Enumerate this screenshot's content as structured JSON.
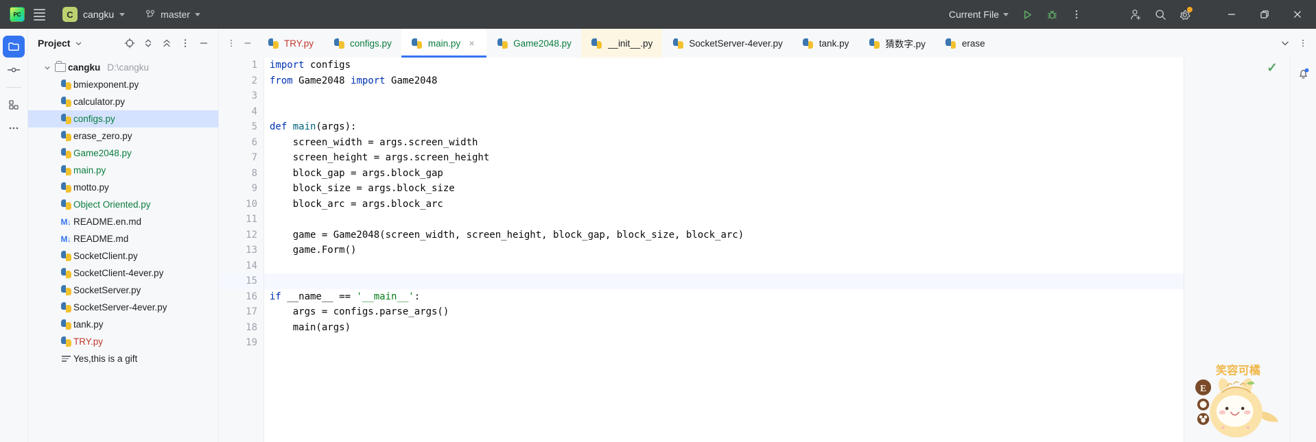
{
  "titlebar": {
    "logo_icon": "pycharm-logo-icon",
    "menu_icon": "hamburger-menu-icon",
    "project_initial": "C",
    "project_name": "cangku",
    "branch_icon": "git-branch-icon",
    "branch_name": "master",
    "run_config": "Current File",
    "run_icon": "run-play-icon",
    "debug_icon": "debug-bug-icon",
    "more_icon": "more-vertical-icon",
    "account_icon": "add-account-icon",
    "search_icon": "search-icon",
    "settings_icon": "gear-icon",
    "minimize_icon": "minimize-icon",
    "maximize_icon": "restore-window-icon",
    "close_icon": "close-icon"
  },
  "rail": {
    "items": [
      {
        "name": "project-tool-window",
        "icon": "folder-icon",
        "active": true
      },
      {
        "name": "commit-tool-window",
        "icon": "commit-icon",
        "active": false
      },
      {
        "name": "structure-tool-window",
        "icon": "structure-blocks-icon",
        "active": false
      },
      {
        "name": "more-tool-windows",
        "icon": "ellipsis-icon",
        "active": false
      }
    ]
  },
  "project_panel": {
    "title": "Project",
    "title_caret_icon": "chevron-down-icon",
    "actions": [
      {
        "name": "select-opened-file-button",
        "icon": "target-icon"
      },
      {
        "name": "expand-collapse-button",
        "icon": "expand-collapse-icon"
      },
      {
        "name": "collapse-all-button",
        "icon": "collapse-all-icon"
      },
      {
        "name": "options-button",
        "icon": "more-vertical-icon"
      },
      {
        "name": "hide-button",
        "icon": "minimize-dash-icon"
      }
    ],
    "root": {
      "label": "cangku",
      "path": "D:\\cangku",
      "icon": "folder-icon",
      "expanded": true
    },
    "files": [
      {
        "label": "bmiexponent.py",
        "icon": "python-file-icon",
        "color": "#1e1f22",
        "selected": false
      },
      {
        "label": "calculator.py",
        "icon": "python-file-icon",
        "color": "#1e1f22",
        "selected": false
      },
      {
        "label": "configs.py",
        "icon": "python-file-icon",
        "color": "#0a7d3e",
        "selected": true
      },
      {
        "label": "erase_zero.py",
        "icon": "python-file-icon",
        "color": "#1e1f22",
        "selected": false
      },
      {
        "label": "Game2048.py",
        "icon": "python-file-icon",
        "color": "#0a7d3e",
        "selected": false
      },
      {
        "label": "main.py",
        "icon": "python-file-icon",
        "color": "#0a7d3e",
        "selected": false
      },
      {
        "label": "motto.py",
        "icon": "python-file-icon",
        "color": "#1e1f22",
        "selected": false
      },
      {
        "label": "Object Oriented.py",
        "icon": "python-file-icon",
        "color": "#0a7d3e",
        "selected": false
      },
      {
        "label": "README.en.md",
        "icon": "markdown-file-icon",
        "color": "#1e1f22",
        "selected": false
      },
      {
        "label": "README.md",
        "icon": "markdown-file-icon",
        "color": "#1e1f22",
        "selected": false
      },
      {
        "label": "SocketClient.py",
        "icon": "python-file-icon",
        "color": "#1e1f22",
        "selected": false
      },
      {
        "label": "SocketClient-4ever.py",
        "icon": "python-file-icon",
        "color": "#1e1f22",
        "selected": false
      },
      {
        "label": "SocketServer.py",
        "icon": "python-file-icon",
        "color": "#1e1f22",
        "selected": false
      },
      {
        "label": "SocketServer-4ever.py",
        "icon": "python-file-icon",
        "color": "#1e1f22",
        "selected": false
      },
      {
        "label": "tank.py",
        "icon": "python-file-icon",
        "color": "#1e1f22",
        "selected": false
      },
      {
        "label": "TRY.py",
        "icon": "python-file-icon",
        "color": "#c0392b",
        "selected": false
      },
      {
        "label": "Yes,this is a gift",
        "icon": "text-file-icon",
        "color": "#1e1f22",
        "selected": false
      }
    ]
  },
  "tabstrip": {
    "left_controls": [
      {
        "name": "tab-list-options-button",
        "icon": "more-vertical-icon"
      },
      {
        "name": "hide-tabs-button",
        "icon": "minimize-dash-icon"
      }
    ],
    "tabs": [
      {
        "label": "TRY.py",
        "icon": "python-file-icon",
        "color": "#c0392b",
        "active": false,
        "closable": false,
        "highlight": false
      },
      {
        "label": "configs.py",
        "icon": "python-file-icon",
        "color": "#0a7d3e",
        "active": false,
        "closable": false,
        "highlight": false
      },
      {
        "label": "main.py",
        "icon": "python-file-icon",
        "color": "#0a7d3e",
        "active": true,
        "closable": true,
        "highlight": false
      },
      {
        "label": "Game2048.py",
        "icon": "python-file-icon",
        "color": "#0a7d3e",
        "active": false,
        "closable": false,
        "highlight": false
      },
      {
        "label": "__init__.py",
        "icon": "python-file-icon",
        "color": "#1e1f22",
        "active": false,
        "closable": false,
        "highlight": true
      },
      {
        "label": "SocketServer-4ever.py",
        "icon": "python-file-icon",
        "color": "#1e1f22",
        "active": false,
        "closable": false,
        "highlight": false
      },
      {
        "label": "tank.py",
        "icon": "python-file-icon",
        "color": "#1e1f22",
        "active": false,
        "closable": false,
        "highlight": false
      },
      {
        "label": "猜数字.py",
        "icon": "python-file-icon",
        "color": "#1e1f22",
        "active": false,
        "closable": false,
        "highlight": false
      },
      {
        "label": "erase",
        "icon": "python-file-icon",
        "color": "#1e1f22",
        "active": false,
        "closable": false,
        "highlight": false
      }
    ],
    "right_controls": [
      {
        "name": "show-hidden-tabs-button",
        "icon": "chevron-down-icon"
      },
      {
        "name": "tab-actions-button",
        "icon": "more-vertical-icon"
      }
    ]
  },
  "editor": {
    "close_glyph": "×",
    "inspection_ok_icon": "checkmark-icon",
    "run_gutter_icon": "run-play-icon",
    "current_line": 15,
    "lines": [
      {
        "n": 1,
        "tokens": [
          {
            "t": "import",
            "c": "kw"
          },
          {
            "t": " configs",
            "c": ""
          }
        ]
      },
      {
        "n": 2,
        "tokens": [
          {
            "t": "from",
            "c": "kw"
          },
          {
            "t": " Game2048 ",
            "c": ""
          },
          {
            "t": "import",
            "c": "kw"
          },
          {
            "t": " Game2048",
            "c": ""
          }
        ]
      },
      {
        "n": 3,
        "tokens": []
      },
      {
        "n": 4,
        "tokens": []
      },
      {
        "n": 5,
        "tokens": [
          {
            "t": "def ",
            "c": "kw"
          },
          {
            "t": "main",
            "c": "fn"
          },
          {
            "t": "(args):",
            "c": ""
          }
        ]
      },
      {
        "n": 6,
        "tokens": [
          {
            "t": "    screen_width = args.screen_width",
            "c": ""
          }
        ]
      },
      {
        "n": 7,
        "tokens": [
          {
            "t": "    screen_height = args.screen_height",
            "c": ""
          }
        ]
      },
      {
        "n": 8,
        "tokens": [
          {
            "t": "    block_gap = args.block_gap",
            "c": ""
          }
        ]
      },
      {
        "n": 9,
        "tokens": [
          {
            "t": "    block_size = args.block_size",
            "c": ""
          }
        ]
      },
      {
        "n": 10,
        "tokens": [
          {
            "t": "    block_arc = args.block_arc",
            "c": ""
          }
        ]
      },
      {
        "n": 11,
        "tokens": []
      },
      {
        "n": 12,
        "tokens": [
          {
            "t": "    game = Game2048(screen_width, screen_height, block_gap, block_size, block_arc)",
            "c": ""
          }
        ]
      },
      {
        "n": 13,
        "tokens": [
          {
            "t": "    game.",
            "c": ""
          },
          {
            "t": "Form",
            "c": ""
          },
          {
            "t": "()",
            "c": ""
          }
        ]
      },
      {
        "n": 14,
        "tokens": []
      },
      {
        "n": 15,
        "tokens": []
      },
      {
        "n": 16,
        "tokens": [
          {
            "t": "if",
            "c": "kw"
          },
          {
            "t": " __name__ == ",
            "c": ""
          },
          {
            "t": "'__main__'",
            "c": "str"
          },
          {
            "t": ":",
            "c": ""
          }
        ],
        "gutter_run": true
      },
      {
        "n": 17,
        "tokens": [
          {
            "t": "    args = configs.parse_args()",
            "c": ""
          }
        ]
      },
      {
        "n": 18,
        "tokens": [
          {
            "t": "    main(args)",
            "c": ""
          }
        ]
      },
      {
        "n": 19,
        "tokens": []
      }
    ]
  },
  "mascot": {
    "caption": "笑容可橘",
    "badge_letter": "E",
    "name": "cat-mascot-sticker"
  },
  "notifications": {
    "bell_icon": "notification-bell-icon",
    "has_badge": true
  },
  "colors": {
    "accent": "#3574f0",
    "titlebar_bg": "#3c3f41",
    "panel_bg": "#f7f8fa",
    "editor_bg": "#ffffff",
    "selection_bg": "#d4e2ff",
    "keyword": "#0033b3",
    "string": "#067d17",
    "function": "#00627a",
    "run_green": "#59a869",
    "warn_orange": "#f5a623"
  }
}
